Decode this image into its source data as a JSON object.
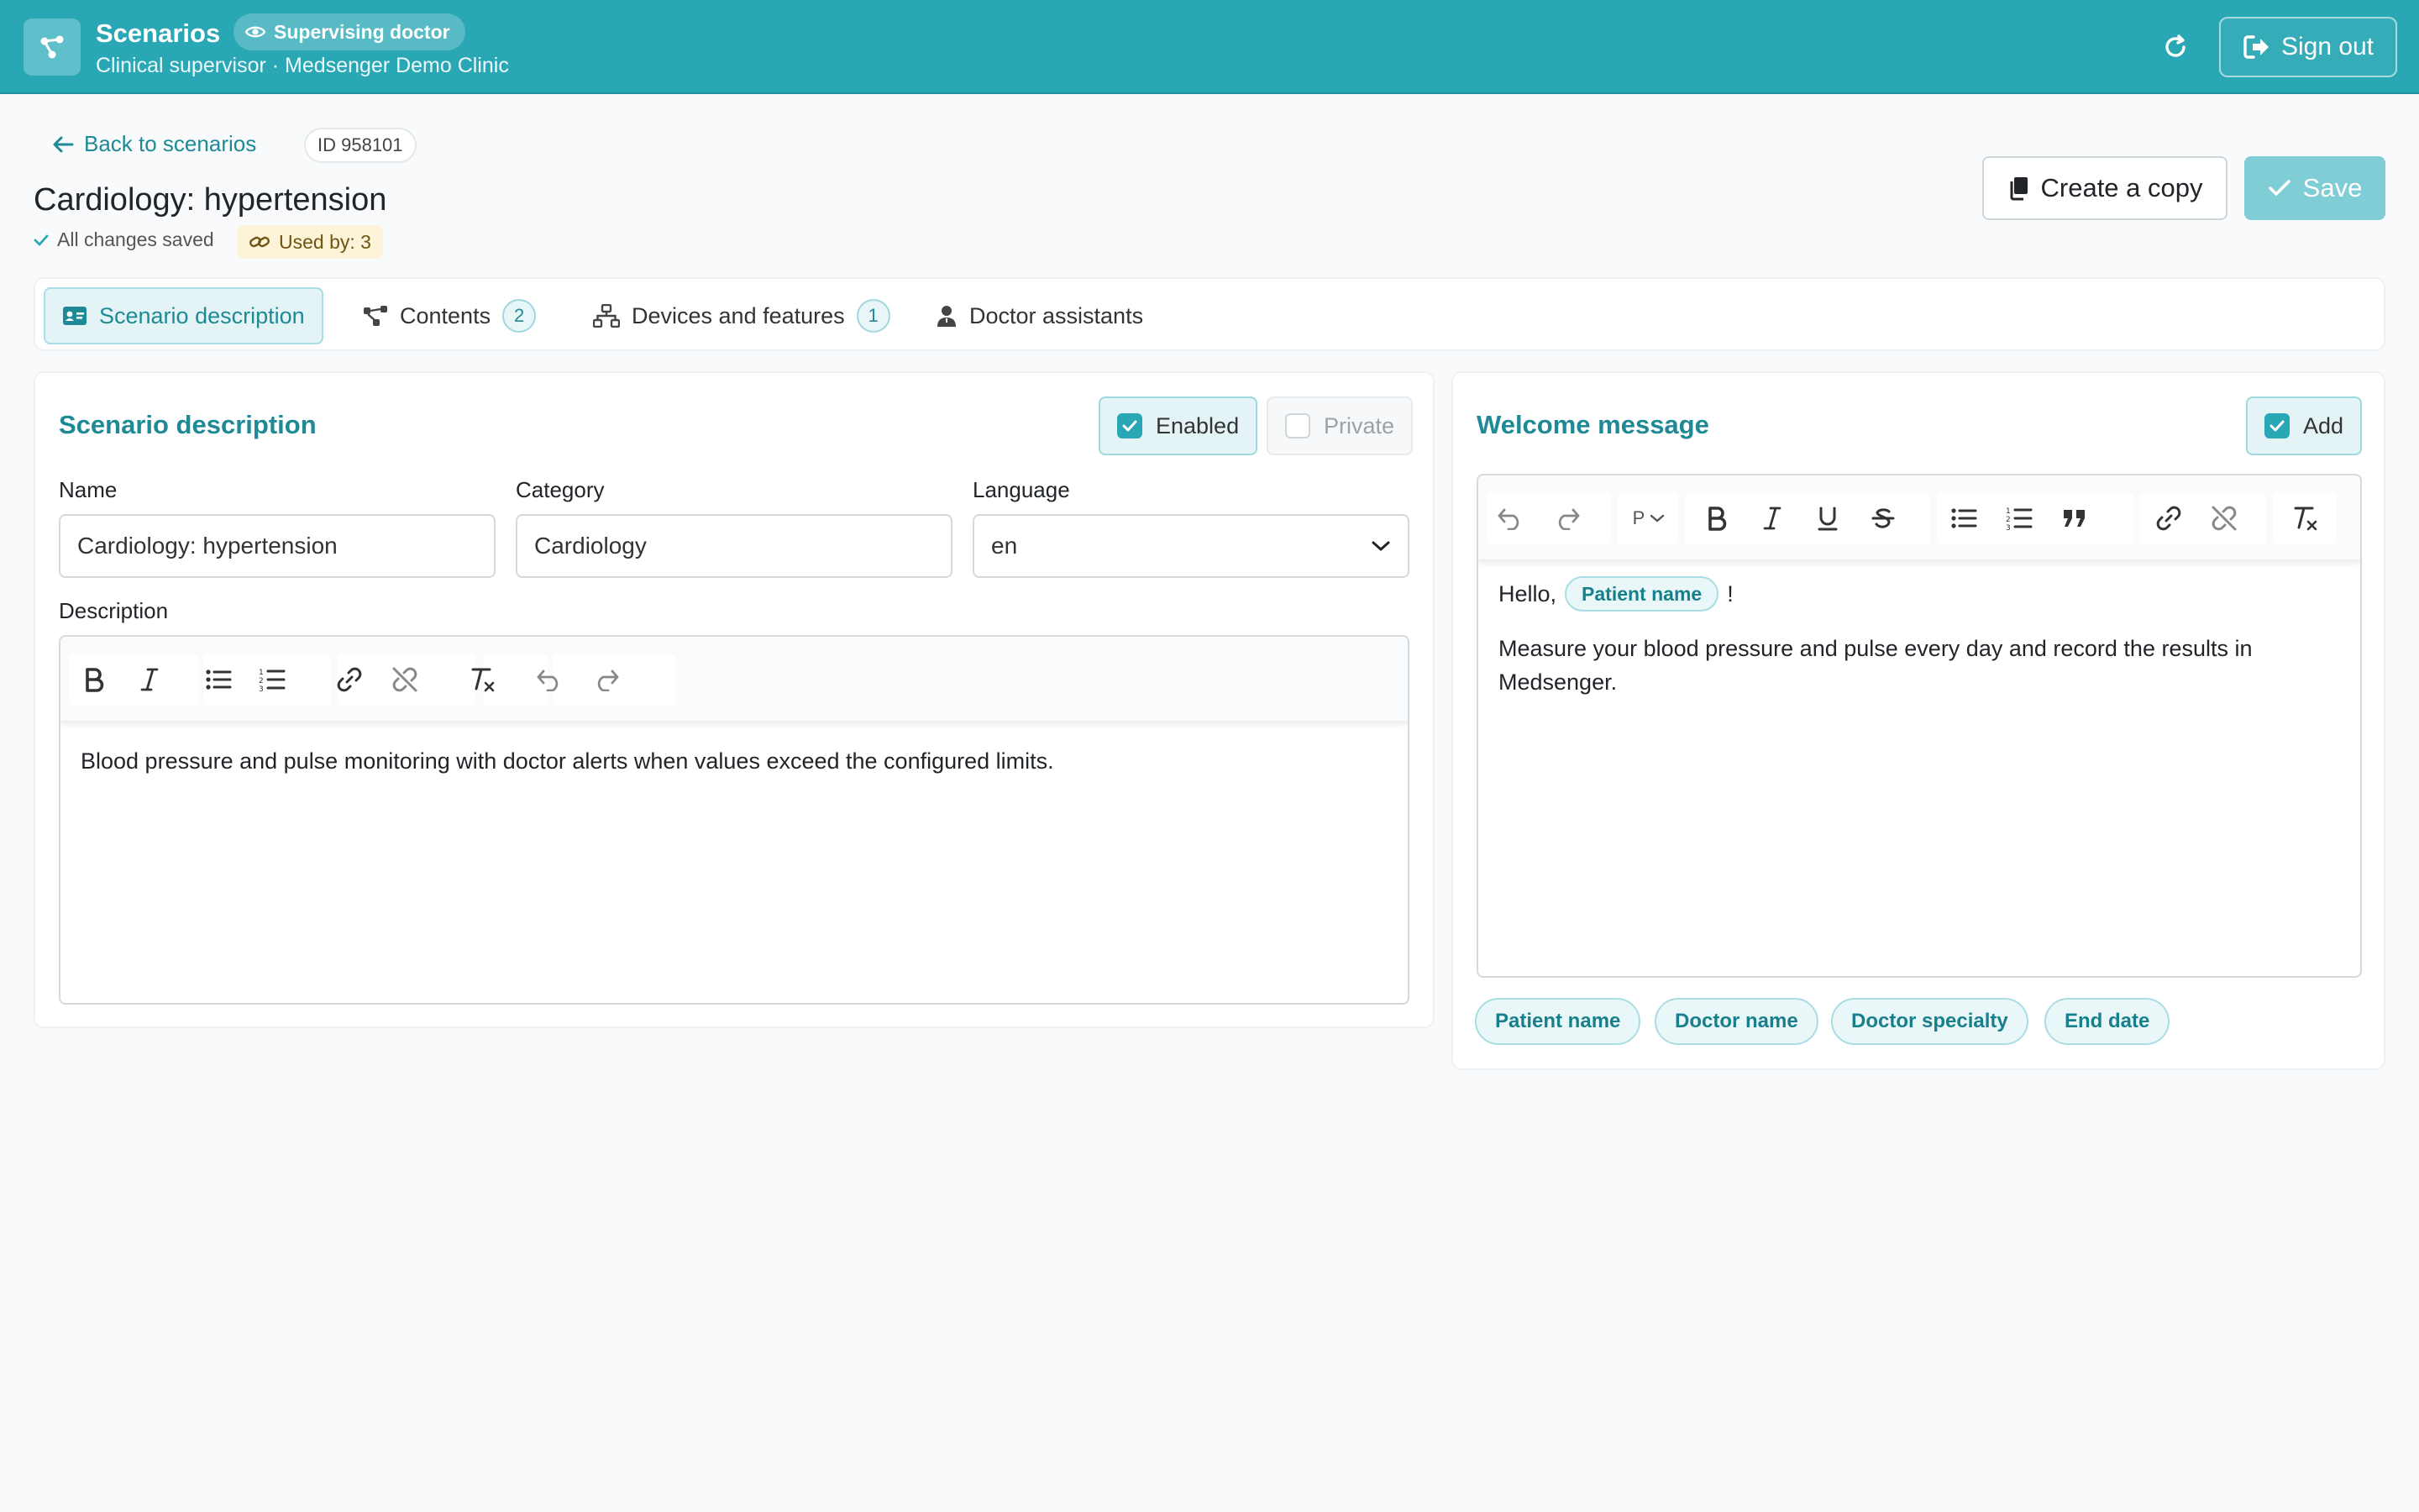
{
  "header": {
    "app_title": "Scenarios",
    "role_badge": "Supervising doctor",
    "subtitle": "Clinical supervisor · Medsenger Demo Clinic",
    "sign_out": "Sign out"
  },
  "page": {
    "back_label": "Back to scenarios",
    "id_label": "ID 958101",
    "title": "Cardiology: hypertension",
    "saved_status": "All changes saved",
    "used_by": "Used by: 3",
    "create_copy": "Create a copy",
    "save": "Save"
  },
  "tabs": [
    {
      "label": "Scenario description",
      "icon": "id-card-icon",
      "active": true
    },
    {
      "label": "Contents",
      "icon": "nodes-icon",
      "count": "2"
    },
    {
      "label": "Devices and features",
      "icon": "sitemap-icon",
      "count": "1"
    },
    {
      "label": "Doctor assistants",
      "icon": "user-doctor-icon"
    }
  ],
  "description_card": {
    "title": "Scenario description",
    "enabled_label": "Enabled",
    "enabled_checked": true,
    "private_label": "Private",
    "private_checked": false,
    "name_label": "Name",
    "name_value": "Cardiology: hypertension",
    "category_label": "Category",
    "category_value": "Cardiology",
    "language_label": "Language",
    "language_value": "en",
    "description_label": "Description",
    "description_text": "Blood pressure and pulse monitoring with doctor alerts when values exceed the configured limits."
  },
  "welcome_card": {
    "title": "Welcome message",
    "add_label": "Add",
    "add_checked": true,
    "format_label": "P",
    "greeting_prefix": "Hello,",
    "greeting_token": "Patient name",
    "greeting_suffix": "!",
    "body": "Measure your blood pressure and pulse every day and record the results in Medsenger.",
    "variables": [
      "Patient name",
      "Doctor name",
      "Doctor specialty",
      "End date"
    ]
  },
  "colors": {
    "header_bg": "#2aa7b4",
    "accent": "#1d8a96",
    "save_bg": "#7fcdd5",
    "used_badge_bg": "#fdf3d8"
  }
}
